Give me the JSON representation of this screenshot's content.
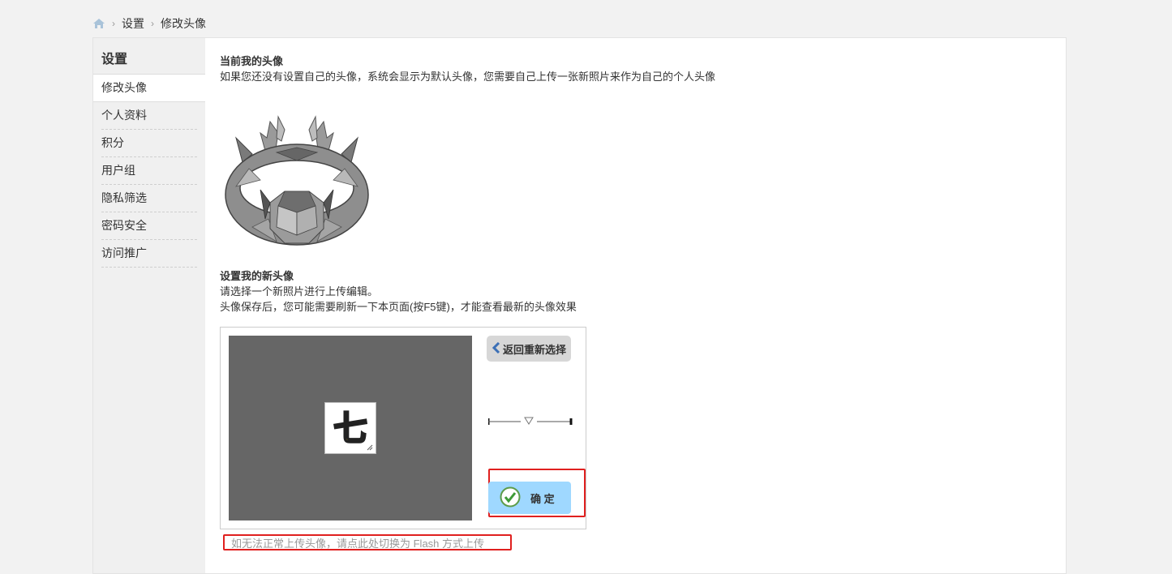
{
  "breadcrumb": {
    "home_icon": "home-icon",
    "items": [
      "设置",
      "修改头像"
    ],
    "separator": "›"
  },
  "sidebar": {
    "title": "设置",
    "items": [
      {
        "label": "修改头像",
        "active": true
      },
      {
        "label": "个人资料"
      },
      {
        "label": "积分"
      },
      {
        "label": "用户组"
      },
      {
        "label": "隐私筛选"
      },
      {
        "label": "密码安全"
      },
      {
        "label": "访问推广"
      }
    ]
  },
  "current_avatar": {
    "heading": "当前我的头像",
    "description": "如果您还没有设置自己的头像，系统会显示为默认头像，您需要自己上传一张新照片来作为自己的个人头像"
  },
  "new_avatar": {
    "heading": "设置我的新头像",
    "line1": "请选择一个新照片进行上传编辑。",
    "line2": "头像保存后，您可能需要刷新一下本页面(按F5键)，才能查看最新的头像效果"
  },
  "editor": {
    "back_label": "返回重新选择",
    "confirm_label": "确 定",
    "thumb_glyph": "七",
    "crop_bg": "#666666",
    "confirm_bg": "#9fd8ff"
  },
  "flash_link": "如无法正常上传头像，请点此处切换为 Flash 方式上传",
  "highlight_color": "#e0201f"
}
